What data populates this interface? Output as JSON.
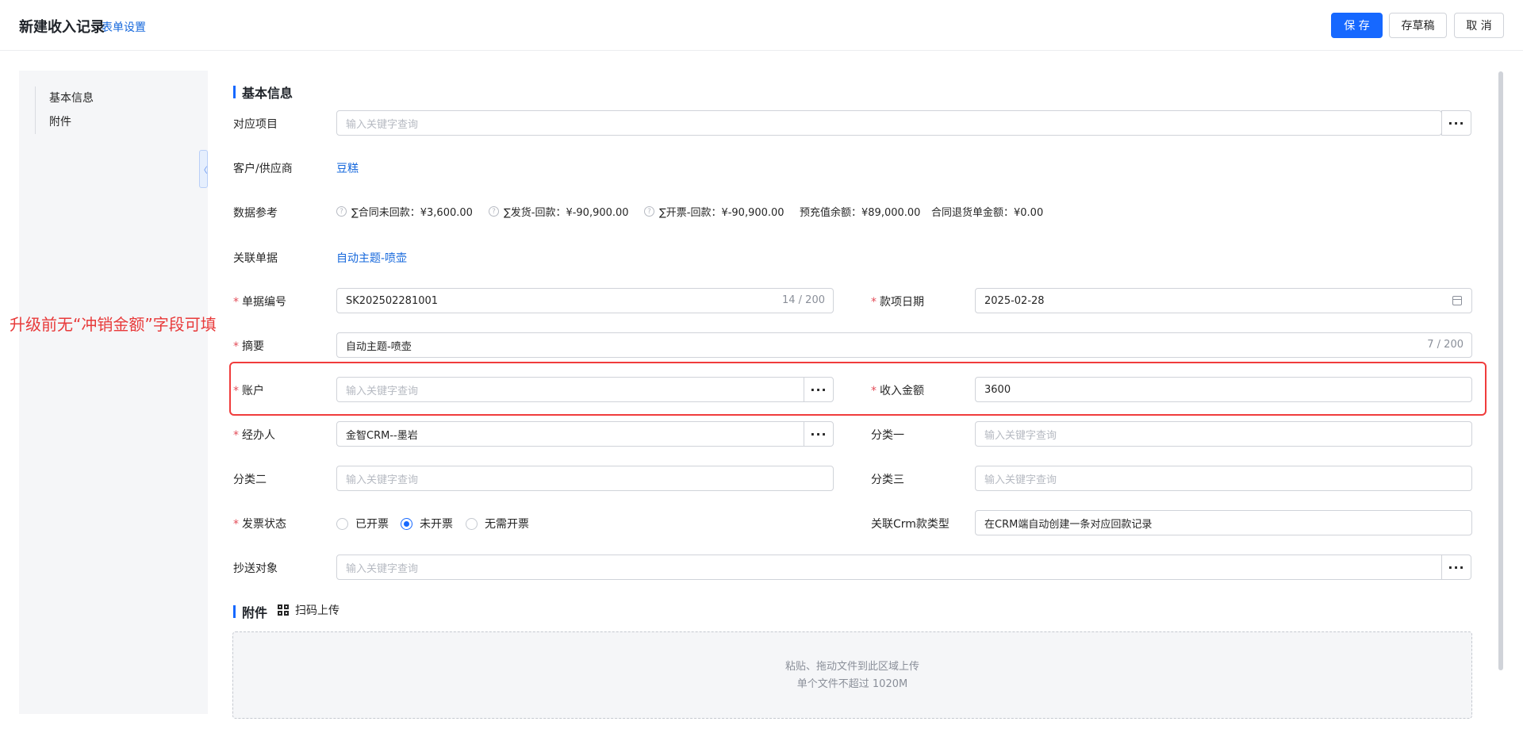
{
  "header": {
    "title": "新建收入记录",
    "form_settings": "表单设置",
    "save": "保 存",
    "draft": "存草稿",
    "cancel": "取 消"
  },
  "sidebar": {
    "items": [
      {
        "label": "基本信息"
      },
      {
        "label": "附件"
      }
    ],
    "collapse_glyph": "〈"
  },
  "annotation": "升级前无“冲销金额”字段可填",
  "basic": {
    "section_title": "基本信息",
    "project": {
      "label": "对应项目",
      "placeholder": "输入关键字查询"
    },
    "customer": {
      "label": "客户/供应商",
      "value": "豆糕"
    },
    "data_ref": {
      "label": "数据参考",
      "items": [
        {
          "text": "∑合同未回款：¥3,600.00",
          "has_help": true
        },
        {
          "text": "∑发货-回款：¥-90,900.00",
          "has_help": true
        },
        {
          "text": "∑开票-回款：¥-90,900.00",
          "has_help": true
        },
        {
          "text": "预充值余额：¥89,000.00",
          "has_help": false
        },
        {
          "text": "合同退货单金额：¥0.00",
          "has_help": false
        }
      ]
    },
    "related": {
      "label": "关联单据",
      "value": "自动主题-喷壶"
    },
    "doc_no": {
      "label": "单据编号",
      "value": "SK202502281001",
      "counter": "14 / 200"
    },
    "pay_date": {
      "label": "款项日期",
      "value": "2025-02-28"
    },
    "summary": {
      "label": "摘要",
      "value": "自动主题-喷壶",
      "counter": "7 / 200"
    },
    "account": {
      "label": "账户",
      "placeholder": "输入关键字查询"
    },
    "income": {
      "label": "收入金额",
      "value": "3600"
    },
    "handler": {
      "label": "经办人",
      "value": "金智CRM--墨岩"
    },
    "cat1": {
      "label": "分类一",
      "placeholder": "输入关键字查询"
    },
    "cat2": {
      "label": "分类二",
      "placeholder": "输入关键字查询"
    },
    "cat3": {
      "label": "分类三",
      "placeholder": "输入关键字查询"
    },
    "invoice": {
      "label": "发票状态",
      "options": [
        "已开票",
        "未开票",
        "无需开票"
      ],
      "selected": "未开票"
    },
    "crm_type": {
      "label": "关联Crm款类型",
      "value": "在CRM端自动创建一条对应回款记录"
    },
    "cc": {
      "label": "抄送对象",
      "placeholder": "输入关键字查询"
    },
    "ellipsis": "···",
    "required_mark": "*"
  },
  "attachments": {
    "section_title": "附件",
    "scan_upload": "扫码上传",
    "drop_line1": "粘贴、拖动文件到此区域上传",
    "drop_line2": "单个文件不超过 1020M"
  },
  "colors": {
    "primary": "#1668ff",
    "link": "#1668dc",
    "required": "#e34d59",
    "annotation": "#e83a3a"
  }
}
